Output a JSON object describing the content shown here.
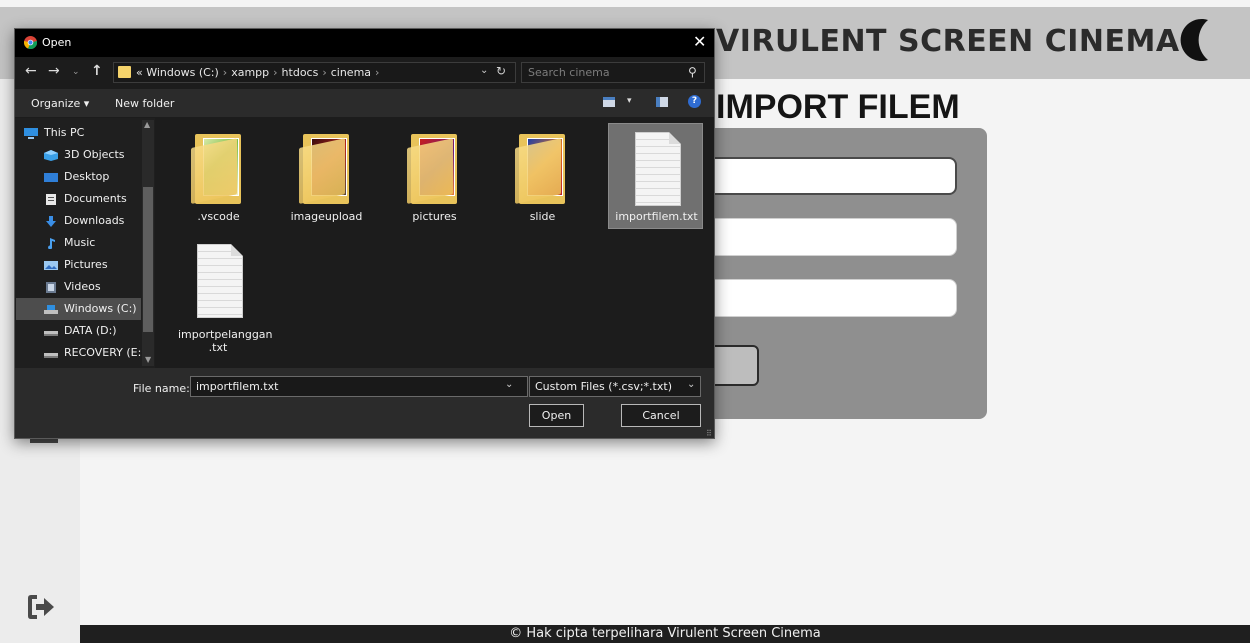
{
  "app": {
    "site_title": "VIRULENT SCREEN CINEMA",
    "page_heading": "IMPORT FILEM",
    "footer_text": "© Hak cipta terpelihara Virulent Screen Cinema"
  },
  "dialog": {
    "title": "Open",
    "close_label": "✕",
    "nav_back": "←",
    "nav_forward": "→",
    "nav_recent": "⌄",
    "nav_up": "↑",
    "address_path": [
      "« Windows (C:)",
      "xampp",
      "htdocs",
      "cinema"
    ],
    "address_dropdown": "⌄",
    "address_refresh": "↻",
    "search_placeholder": "Search cinema",
    "search_icon": "⚲",
    "toolbar": {
      "organize_label": "Organize ▾",
      "new_folder_label": "New folder",
      "view_chevron": "▾",
      "help_label": "?"
    },
    "nav_items": [
      {
        "label": "This PC",
        "icon": "computer-icon",
        "selected": false
      },
      {
        "label": "3D Objects",
        "icon": "3d-objects-icon",
        "selected": false
      },
      {
        "label": "Desktop",
        "icon": "desktop-icon",
        "selected": false
      },
      {
        "label": "Documents",
        "icon": "documents-icon",
        "selected": false
      },
      {
        "label": "Downloads",
        "icon": "downloads-icon",
        "selected": false
      },
      {
        "label": "Music",
        "icon": "music-icon",
        "selected": false
      },
      {
        "label": "Pictures",
        "icon": "pictures-icon",
        "selected": false
      },
      {
        "label": "Videos",
        "icon": "videos-icon",
        "selected": false
      },
      {
        "label": "Windows (C:)",
        "icon": "drive-icon",
        "selected": true
      },
      {
        "label": "DATA (D:)",
        "icon": "drive-icon",
        "selected": false
      },
      {
        "label": "RECOVERY (E:)",
        "icon": "drive-icon",
        "selected": false
      }
    ],
    "files": [
      {
        "name": ".vscode",
        "type": "folder",
        "selected": false
      },
      {
        "name": "imageupload",
        "type": "folder",
        "selected": false
      },
      {
        "name": "pictures",
        "type": "folder",
        "selected": false
      },
      {
        "name": "slide",
        "type": "folder",
        "selected": false
      },
      {
        "name": "importfilem.txt",
        "type": "text-file",
        "selected": true
      },
      {
        "name": "importpelanggan .txt",
        "type": "text-file",
        "selected": false
      }
    ],
    "filename_label": "File name:",
    "filename_value": "importfilem.txt",
    "filetype_value": "Custom Files (*.csv;*.txt)",
    "open_label": "Open",
    "cancel_label": "Cancel",
    "dropdown_chevron": "⌄",
    "resize_grip": "⠿"
  },
  "colors": {
    "header_bg": "#c4c4c4",
    "panel_bg": "#8f8f8f",
    "dialog_bg": "#1c1c1c",
    "selected_file_bg": "#707070",
    "folder_yellow": "#edc45a"
  }
}
